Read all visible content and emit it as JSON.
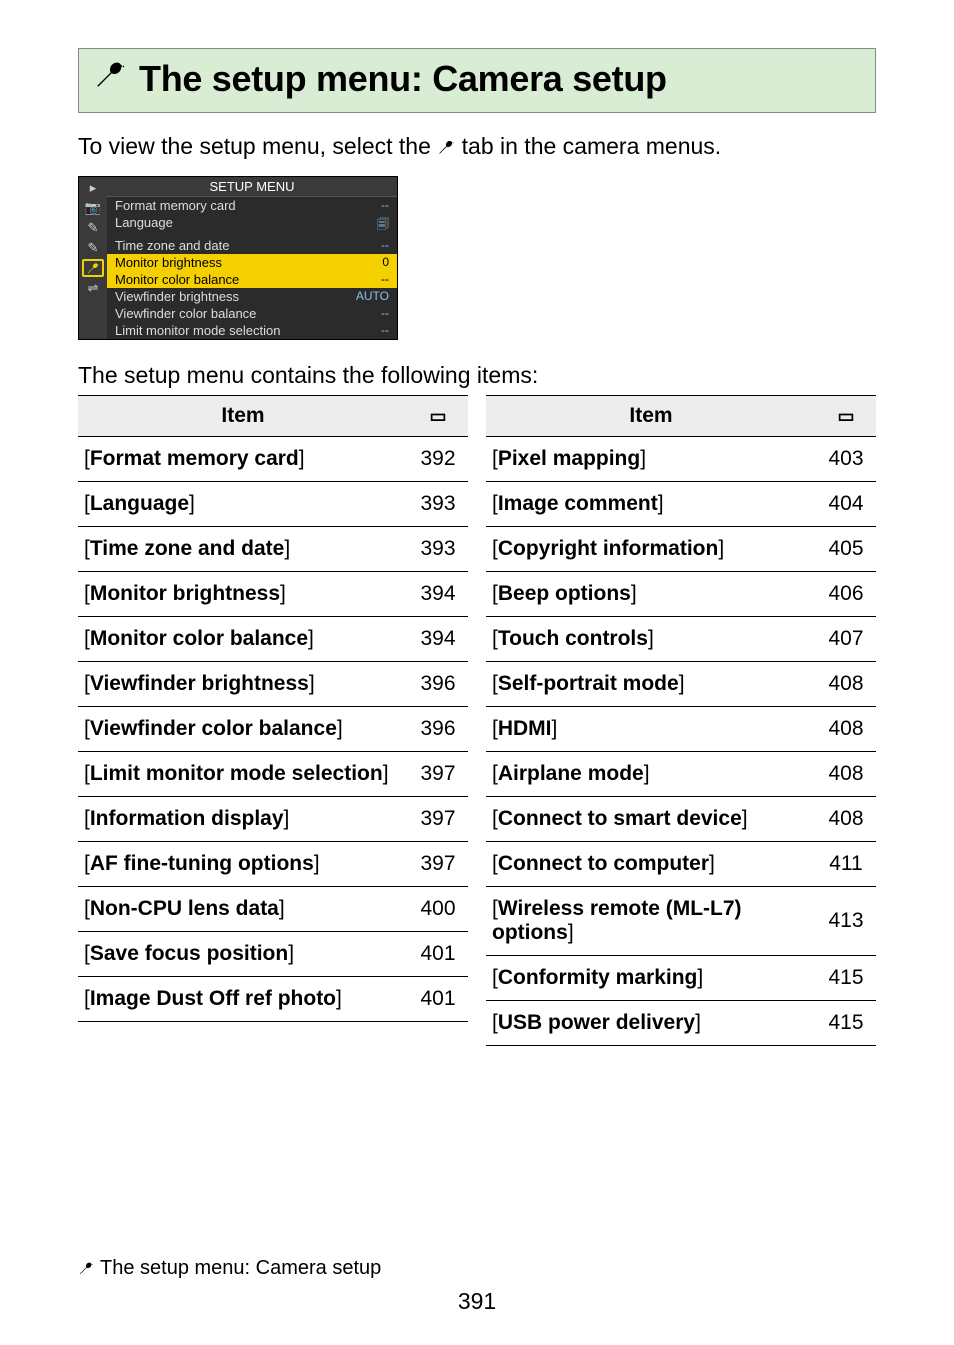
{
  "title_icon": "wrench-icon",
  "title": "The setup menu: Camera setup",
  "intro_prefix": "To view the setup menu, select the ",
  "intro_suffix": " tab in the camera menus.",
  "menu_screenshot": {
    "title": "SETUP MENU",
    "sidebar_icons": [
      "▸",
      "📷",
      "✎",
      "",
      "⚙",
      "⇌"
    ],
    "rows": [
      {
        "label": "Format memory card",
        "value": "--"
      },
      {
        "label": "Language",
        "value": "🗐"
      },
      {
        "label": "Time zone and date",
        "value": "--"
      },
      {
        "label": "Monitor brightness",
        "value": "0",
        "highlight": true
      },
      {
        "label": "Monitor color balance",
        "value": "--",
        "highlight": true
      },
      {
        "label": "Viewfinder brightness",
        "value": "AUTO"
      },
      {
        "label": "Viewfinder color balance",
        "value": "--"
      },
      {
        "label": "Limit monitor mode selection",
        "value": "--"
      }
    ]
  },
  "subintro": "The setup menu contains the following items:",
  "table_header_item": "Item",
  "left_items": [
    {
      "name": "Format memory card",
      "page": "392"
    },
    {
      "name": "Language",
      "page": "393"
    },
    {
      "name": "Time zone and date",
      "page": "393"
    },
    {
      "name": "Monitor brightness",
      "page": "394"
    },
    {
      "name": "Monitor color balance",
      "page": "394"
    },
    {
      "name": "Viewfinder brightness",
      "page": "396"
    },
    {
      "name": "Viewfinder color balance",
      "page": "396"
    },
    {
      "name": "Limit monitor mode selection",
      "page": "397"
    },
    {
      "name": "Information display",
      "page": "397"
    },
    {
      "name": "AF fine-tuning options",
      "page": "397"
    },
    {
      "name": "Non-CPU lens data",
      "page": "400"
    },
    {
      "name": "Save focus position",
      "page": "401"
    },
    {
      "name": "Image Dust Off ref photo",
      "page": "401"
    }
  ],
  "right_items": [
    {
      "name": "Pixel mapping",
      "page": "403"
    },
    {
      "name": "Image comment",
      "page": "404"
    },
    {
      "name": "Copyright information",
      "page": "405"
    },
    {
      "name": "Beep options",
      "page": "406"
    },
    {
      "name": "Touch controls",
      "page": "407"
    },
    {
      "name": "Self-portrait mode",
      "page": "408"
    },
    {
      "name": "HDMI",
      "page": "408"
    },
    {
      "name": "Airplane mode",
      "page": "408"
    },
    {
      "name": "Connect to smart device",
      "page": "408"
    },
    {
      "name": "Connect to computer",
      "page": "411"
    },
    {
      "name": "Wireless remote (ML-L7) options",
      "page": "413"
    },
    {
      "name": "Conformity marking",
      "page": "415"
    },
    {
      "name": "USB power delivery",
      "page": "415"
    }
  ],
  "footer_text": "The setup menu: Camera setup",
  "page_number": "391"
}
